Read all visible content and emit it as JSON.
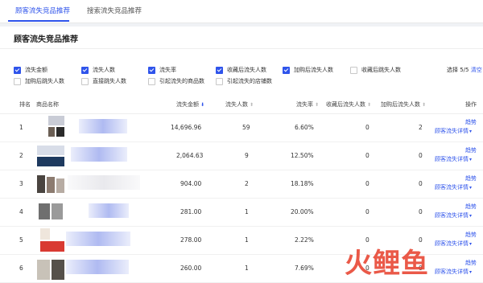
{
  "tabs": [
    {
      "label": "顾客流失竞品推荐",
      "active": true
    },
    {
      "label": "搜索流失竞品推荐",
      "active": false
    }
  ],
  "card_title": "顾客流失竞品推荐",
  "metric_options": [
    {
      "label": "流失金额",
      "checked": true
    },
    {
      "label": "流失人数",
      "checked": true
    },
    {
      "label": "流失率",
      "checked": true
    },
    {
      "label": "收藏后流失人数",
      "checked": true
    },
    {
      "label": "加购后流失人数",
      "checked": true
    },
    {
      "label": "收藏后跳失人数",
      "checked": false
    },
    {
      "label": "加购后跳失人数",
      "checked": false
    },
    {
      "label": "直接跳失人数",
      "checked": false
    },
    {
      "label": "引起流失的商品数",
      "checked": false
    },
    {
      "label": "引起流失的店铺数",
      "checked": false
    }
  ],
  "selection": {
    "text": "选择 5/5",
    "reset_label": "清空"
  },
  "columns": {
    "rank": "排名",
    "product": "商品名称",
    "amount": "流失金额",
    "users": "流失人数",
    "rate": "流失率",
    "fav": "收藏后流失人数",
    "cart": "加购后流失人数",
    "action": "操作"
  },
  "rows": [
    {
      "rank": "1",
      "amount": "14,696.96",
      "users": "59",
      "rate": "6.60%",
      "fav": "0",
      "cart": "2"
    },
    {
      "rank": "2",
      "amount": "2,064.63",
      "users": "9",
      "rate": "12.50%",
      "fav": "0",
      "cart": "0"
    },
    {
      "rank": "3",
      "amount": "904.00",
      "users": "2",
      "rate": "18.18%",
      "fav": "0",
      "cart": "0"
    },
    {
      "rank": "4",
      "amount": "281.00",
      "users": "1",
      "rate": "20.00%",
      "fav": "0",
      "cart": "0"
    },
    {
      "rank": "5",
      "amount": "278.00",
      "users": "1",
      "rate": "2.22%",
      "fav": "0",
      "cart": "0"
    },
    {
      "rank": "6",
      "amount": "260.00",
      "users": "1",
      "rate": "7.69%",
      "fav": "0",
      "cart": "0"
    }
  ],
  "actions": {
    "trend": "趋势",
    "detail": "顾客流失详情"
  },
  "watermark": "火鲤鱼",
  "colors": {
    "accent": "#2f54eb"
  }
}
